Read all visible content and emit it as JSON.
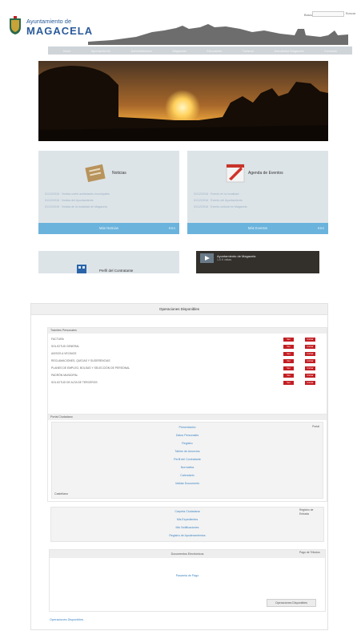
{
  "site": {
    "brand_top": "Ayuntamiento de",
    "brand_name": "MAGACELA",
    "search_label": "Buscar",
    "search_button": "Buscar",
    "nav": [
      "Inicio",
      "Ayuntamiento",
      "Administración",
      "Magacela",
      "Educación",
      "Turismo",
      "Actualidad Magacela",
      "Contacto"
    ]
  },
  "cards": [
    {
      "title": "Noticias",
      "lines": [
        "01/12/2016 · Noticia sobre actividades municipales",
        "01/12/2016 · Noticia del Ayuntamiento",
        "01/12/2016 · Noticia de la localidad de Magacela"
      ],
      "more": "Más Noticias",
      "rss": "RSS",
      "icon": "news-icon"
    },
    {
      "title": "Agenda de Eventos",
      "lines": [
        "01/12/2016 · Evento en la localidad",
        "01/12/2016 · Evento del Ayuntamiento",
        "01/12/2016 · Evento cultural en Magacela"
      ],
      "more": "Más Eventos",
      "rss": "RSS",
      "icon": "calendar-icon"
    },
    {
      "title": "Perfil del Contratante",
      "icon": "building-icon"
    }
  ],
  "video": {
    "title": "Ayuntamiento de Magacela",
    "subtitle": "1.5 K vistas"
  },
  "ops": {
    "title": "Operaciones Disponibles",
    "tramites": {
      "header": "Trámites Personales",
      "rows": [
        "FACTURA",
        "SOLICITUD GENERAL",
        "AVISOS A VECINOS",
        "RECLAMACIONES, QUEJAS Y SUGERENCIAS",
        "PLANES DE EMPLEO, BOLSAS Y SELECCIÓN DE PERSONAL",
        "PADRÓN MUNICIPAL",
        "SOLICITUD DE ALTA DE TERCEROS"
      ],
      "btn_a": "Ver",
      "btn_b": "Iniciar"
    },
    "portal": {
      "header": "Portal Ciudadano",
      "links": [
        "Presentación",
        "Datos Personales",
        "Registro",
        "Tablón de Anuncios",
        "Perfil del Contratante",
        "Normativa",
        "Calendario",
        "Validar Documento"
      ],
      "side": "Portal",
      "footer": "Castellano"
    },
    "box2": {
      "links": [
        "Carpeta Ciudadana",
        "Mis Expedientes",
        "Mis Notificaciones",
        "Registro de Apoderamientos"
      ],
      "side": "Registro de Entrada"
    },
    "box3": {
      "header": "Documentos Electrónicos",
      "side": "Pago de Tributos",
      "link": "Pasarela de Pago",
      "button": "Operaciones Disponibles"
    },
    "footer": "Operaciones Disponibles"
  },
  "colors": {
    "nav": "#cfd4d8",
    "card_bar": "#6ab3dc",
    "red_button": "#c31d22",
    "link": "#3f86c4"
  }
}
